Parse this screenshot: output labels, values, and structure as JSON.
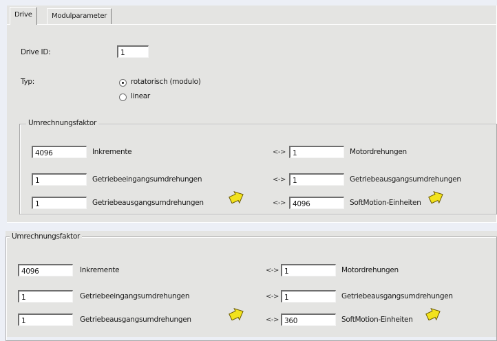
{
  "tabs": [
    "Drive",
    "Modulparameter"
  ],
  "drive_id": {
    "label": "Drive ID:",
    "value": "1"
  },
  "typ": {
    "label": "Typ:",
    "options": [
      {
        "label": "rotatorisch (modulo)",
        "selected": true
      },
      {
        "label": "linear",
        "selected": false
      }
    ]
  },
  "group_top": {
    "title": "Umrechnungsfaktor",
    "rows": [
      {
        "left_value": "4096",
        "left_label": "Inkremente",
        "arrow": "<->",
        "right_value": "1",
        "right_label": "Motordrehungen",
        "pointer": false
      },
      {
        "left_value": "1",
        "left_label": "Getriebeeingangsumdrehungen",
        "arrow": "<->",
        "right_value": "1",
        "right_label": "Getriebeausgangsumdrehungen",
        "pointer": false
      },
      {
        "left_value": "1",
        "left_label": "Getriebeausgangsumdrehungen",
        "arrow": "<->",
        "right_value": "4096",
        "right_label": "SoftMotion-Einheiten",
        "pointer": true
      }
    ]
  },
  "group_bottom": {
    "title": "Umrechnungsfaktor",
    "rows": [
      {
        "left_value": "4096",
        "left_label": "Inkremente",
        "arrow": "<->",
        "right_value": "1",
        "right_label": "Motordrehungen",
        "pointer": false
      },
      {
        "left_value": "1",
        "left_label": "Getriebeeingangsumdrehungen",
        "arrow": "<->",
        "right_value": "1",
        "right_label": "Getriebeausgangsumdrehungen",
        "pointer": false
      },
      {
        "left_value": "1",
        "left_label": "Getriebeausgangsumdrehungen",
        "arrow": "<->",
        "right_value": "360",
        "right_label": "SoftMotion-Einheiten",
        "pointer": true
      }
    ]
  },
  "colors": {
    "panel": "#e4e4e2",
    "background": "#eceff6",
    "pointer": "#f2e21c"
  }
}
